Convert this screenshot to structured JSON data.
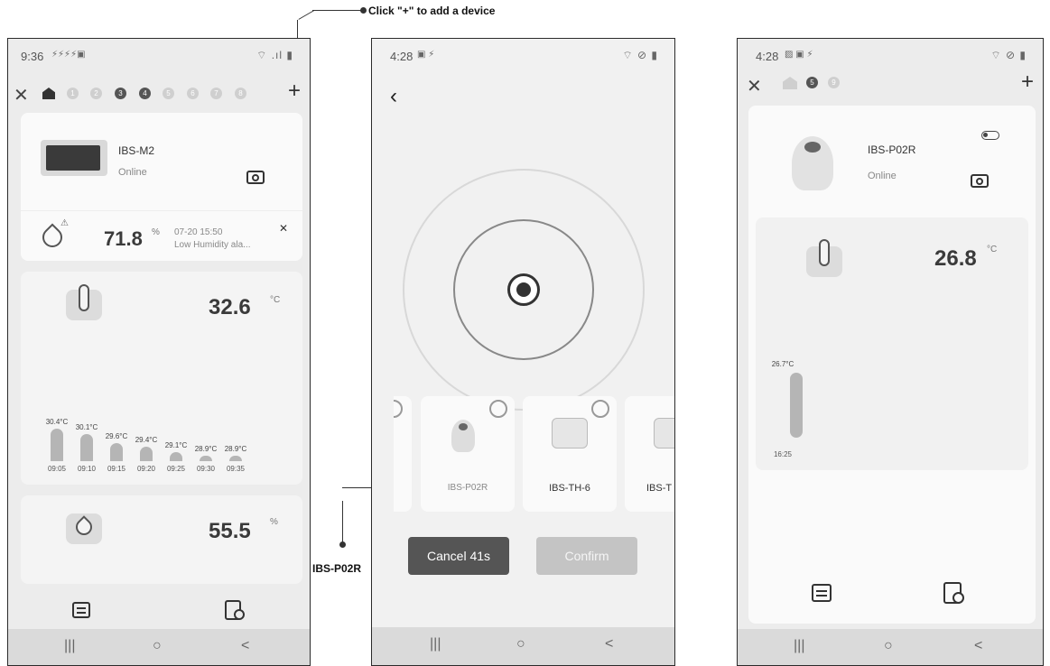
{
  "annotations": {
    "top_callout": "Click \"+\" to add a device",
    "side_callout": "IBS-P02R"
  },
  "phone1": {
    "status_time": "9:36",
    "dots": [
      "1",
      "2",
      "3",
      "4",
      "5",
      "6",
      "7",
      "8"
    ],
    "device_name": "IBS-M2",
    "device_status": "Online",
    "alarm_value": "71.8",
    "alarm_unit": "%",
    "alarm_time": "07-20 15:50",
    "alarm_text": "Low Humidity ala...",
    "temp_value": "32.6",
    "temp_unit": "°C",
    "history": [
      {
        "value": "30.4°C",
        "time": "09:05"
      },
      {
        "value": "30.1°C",
        "time": "09:10"
      },
      {
        "value": "29.6°C",
        "time": "09:15"
      },
      {
        "value": "29.4°C",
        "time": "09:20"
      },
      {
        "value": "29.1°C",
        "time": "09:25"
      },
      {
        "value": "28.9°C",
        "time": "09:30"
      },
      {
        "value": "28.9°C",
        "time": "09:35"
      }
    ],
    "humidity_value": "55.5",
    "humidity_unit": "%"
  },
  "phone2": {
    "status_time": "4:28",
    "devices": [
      "IBS-P02R",
      "IBS-TH-6",
      "IBS-T"
    ],
    "cancel_label": "Cancel  41s",
    "confirm_label": "Confirm"
  },
  "phone3": {
    "status_time": "4:28",
    "dots": [
      "5",
      "9"
    ],
    "device_name": "IBS-P02R",
    "device_status": "Online",
    "temp_value": "26.8",
    "temp_unit": "°C",
    "bar_value": "26.7°C",
    "bar_time": "16:25"
  },
  "navbar": {
    "recent": "|||",
    "home": "○",
    "back": "<"
  }
}
